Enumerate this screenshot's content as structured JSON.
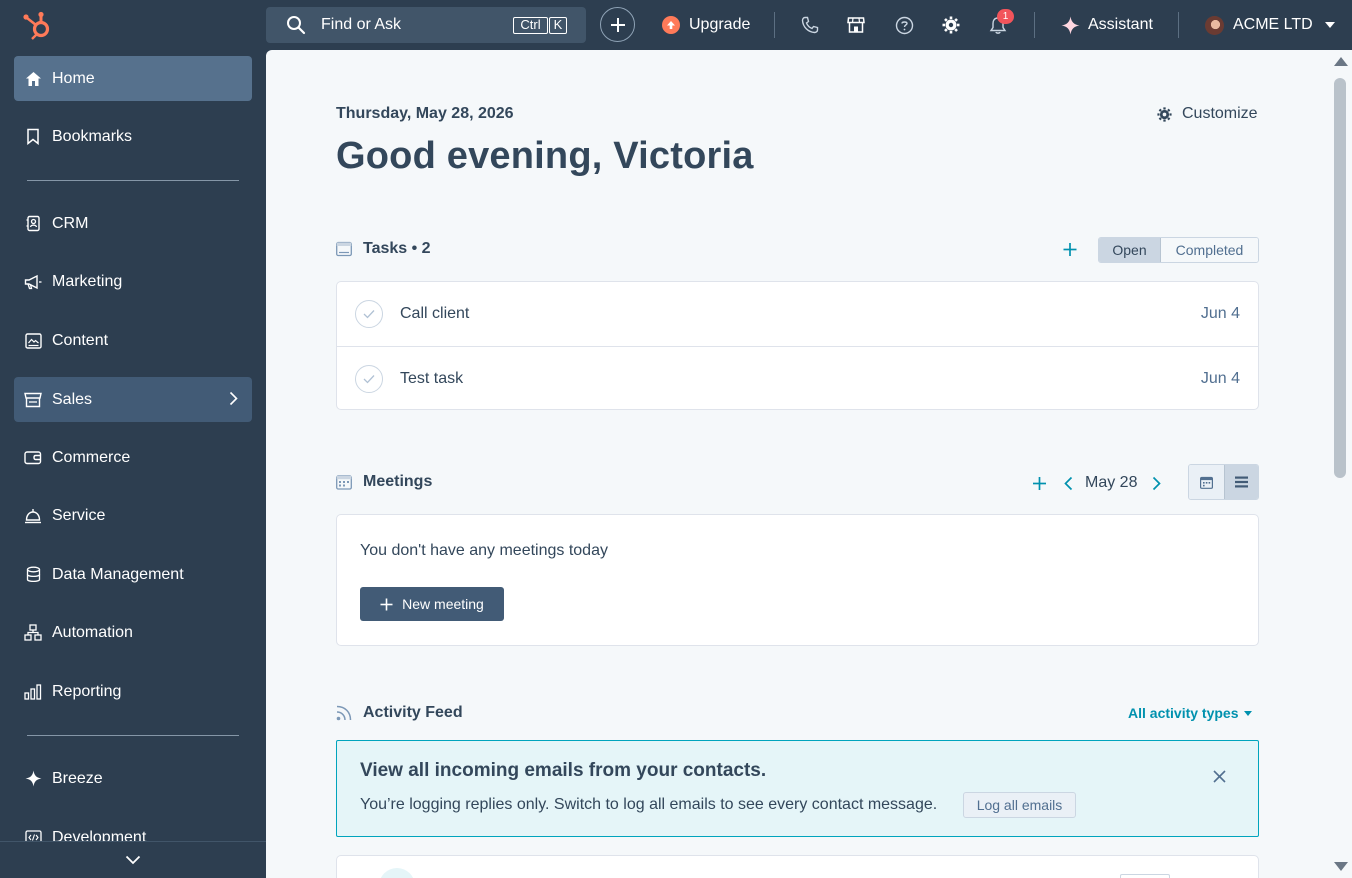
{
  "topbar": {
    "search_placeholder": "Find or Ask",
    "shortcut_key1": "Ctrl",
    "shortcut_key2": "K",
    "upgrade_label": "Upgrade",
    "notification_count": "1",
    "assistant_label": "Assistant",
    "account_name": "ACME LTD",
    "icons": [
      "hubspot-logo",
      "search-icon",
      "plus-icon",
      "upgrade-icon",
      "phone-icon",
      "marketplace-icon",
      "help-icon",
      "gear-icon",
      "bell-icon",
      "sparkle-icon",
      "avatar",
      "caret-down-icon"
    ]
  },
  "sidebar": {
    "items": [
      {
        "label": "Home",
        "icon": "home-icon",
        "state": "active"
      },
      {
        "label": "Bookmarks",
        "icon": "bookmark-icon"
      },
      {
        "label": "CRM",
        "icon": "contacts-icon"
      },
      {
        "label": "Marketing",
        "icon": "megaphone-icon"
      },
      {
        "label": "Content",
        "icon": "content-icon"
      },
      {
        "label": "Sales",
        "icon": "sales-icon",
        "state": "hover",
        "has_submenu": true
      },
      {
        "label": "Commerce",
        "icon": "wallet-icon"
      },
      {
        "label": "Service",
        "icon": "bell-service-icon"
      },
      {
        "label": "Data Management",
        "icon": "database-icon"
      },
      {
        "label": "Automation",
        "icon": "workflow-icon"
      },
      {
        "label": "Reporting",
        "icon": "bar-chart-icon"
      },
      {
        "label": "Breeze",
        "icon": "sparkle-icon"
      },
      {
        "label": "Development",
        "icon": "code-icon"
      }
    ]
  },
  "main": {
    "date": "Thursday, May 28, 2026",
    "greeting": "Good evening, Victoria",
    "customize_label": "Customize",
    "tasks": {
      "title": "Tasks • 2",
      "toggle_open": "Open",
      "toggle_completed": "Completed",
      "selected": "Open",
      "rows": [
        {
          "name": "Call client",
          "due": "Jun 4"
        },
        {
          "name": "Test task",
          "due": "Jun 4"
        }
      ]
    },
    "meetings": {
      "title": "Meetings",
      "current_date": "May 28",
      "empty_text": "You don't have any meetings today",
      "new_meeting_label": "New meeting",
      "view_selected": "list"
    },
    "activity_feed": {
      "title": "Activity Feed",
      "filter_label": "All activity types",
      "banner_title": "View all incoming emails from your contacts.",
      "banner_body": "You’re logging replies only. Switch to log all emails to see every contact message.",
      "banner_button": "Log all emails"
    }
  },
  "colors": {
    "nav_bg": "#2d3e50",
    "nav_active": "#56718d",
    "main_bg": "#f5f8fa",
    "accent_teal": "#0091ae",
    "brand_orange": "#ff7a59",
    "badge_red": "#f2545b",
    "text_dark": "#33475b"
  }
}
